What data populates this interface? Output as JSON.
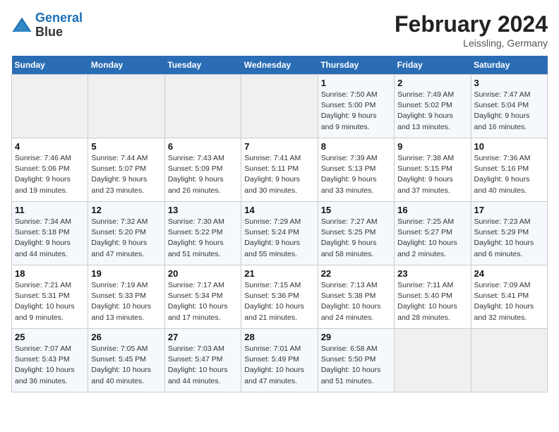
{
  "header": {
    "logo_line1": "General",
    "logo_line2": "Blue",
    "month": "February 2024",
    "location": "Leissling, Germany"
  },
  "weekdays": [
    "Sunday",
    "Monday",
    "Tuesday",
    "Wednesday",
    "Thursday",
    "Friday",
    "Saturday"
  ],
  "weeks": [
    [
      {
        "day": "",
        "info": ""
      },
      {
        "day": "",
        "info": ""
      },
      {
        "day": "",
        "info": ""
      },
      {
        "day": "",
        "info": ""
      },
      {
        "day": "1",
        "info": "Sunrise: 7:50 AM\nSunset: 5:00 PM\nDaylight: 9 hours\nand 9 minutes."
      },
      {
        "day": "2",
        "info": "Sunrise: 7:49 AM\nSunset: 5:02 PM\nDaylight: 9 hours\nand 13 minutes."
      },
      {
        "day": "3",
        "info": "Sunrise: 7:47 AM\nSunset: 5:04 PM\nDaylight: 9 hours\nand 16 minutes."
      }
    ],
    [
      {
        "day": "4",
        "info": "Sunrise: 7:46 AM\nSunset: 5:06 PM\nDaylight: 9 hours\nand 19 minutes."
      },
      {
        "day": "5",
        "info": "Sunrise: 7:44 AM\nSunset: 5:07 PM\nDaylight: 9 hours\nand 23 minutes."
      },
      {
        "day": "6",
        "info": "Sunrise: 7:43 AM\nSunset: 5:09 PM\nDaylight: 9 hours\nand 26 minutes."
      },
      {
        "day": "7",
        "info": "Sunrise: 7:41 AM\nSunset: 5:11 PM\nDaylight: 9 hours\nand 30 minutes."
      },
      {
        "day": "8",
        "info": "Sunrise: 7:39 AM\nSunset: 5:13 PM\nDaylight: 9 hours\nand 33 minutes."
      },
      {
        "day": "9",
        "info": "Sunrise: 7:38 AM\nSunset: 5:15 PM\nDaylight: 9 hours\nand 37 minutes."
      },
      {
        "day": "10",
        "info": "Sunrise: 7:36 AM\nSunset: 5:16 PM\nDaylight: 9 hours\nand 40 minutes."
      }
    ],
    [
      {
        "day": "11",
        "info": "Sunrise: 7:34 AM\nSunset: 5:18 PM\nDaylight: 9 hours\nand 44 minutes."
      },
      {
        "day": "12",
        "info": "Sunrise: 7:32 AM\nSunset: 5:20 PM\nDaylight: 9 hours\nand 47 minutes."
      },
      {
        "day": "13",
        "info": "Sunrise: 7:30 AM\nSunset: 5:22 PM\nDaylight: 9 hours\nand 51 minutes."
      },
      {
        "day": "14",
        "info": "Sunrise: 7:29 AM\nSunset: 5:24 PM\nDaylight: 9 hours\nand 55 minutes."
      },
      {
        "day": "15",
        "info": "Sunrise: 7:27 AM\nSunset: 5:25 PM\nDaylight: 9 hours\nand 58 minutes."
      },
      {
        "day": "16",
        "info": "Sunrise: 7:25 AM\nSunset: 5:27 PM\nDaylight: 10 hours\nand 2 minutes."
      },
      {
        "day": "17",
        "info": "Sunrise: 7:23 AM\nSunset: 5:29 PM\nDaylight: 10 hours\nand 6 minutes."
      }
    ],
    [
      {
        "day": "18",
        "info": "Sunrise: 7:21 AM\nSunset: 5:31 PM\nDaylight: 10 hours\nand 9 minutes."
      },
      {
        "day": "19",
        "info": "Sunrise: 7:19 AM\nSunset: 5:33 PM\nDaylight: 10 hours\nand 13 minutes."
      },
      {
        "day": "20",
        "info": "Sunrise: 7:17 AM\nSunset: 5:34 PM\nDaylight: 10 hours\nand 17 minutes."
      },
      {
        "day": "21",
        "info": "Sunrise: 7:15 AM\nSunset: 5:36 PM\nDaylight: 10 hours\nand 21 minutes."
      },
      {
        "day": "22",
        "info": "Sunrise: 7:13 AM\nSunset: 5:38 PM\nDaylight: 10 hours\nand 24 minutes."
      },
      {
        "day": "23",
        "info": "Sunrise: 7:11 AM\nSunset: 5:40 PM\nDaylight: 10 hours\nand 28 minutes."
      },
      {
        "day": "24",
        "info": "Sunrise: 7:09 AM\nSunset: 5:41 PM\nDaylight: 10 hours\nand 32 minutes."
      }
    ],
    [
      {
        "day": "25",
        "info": "Sunrise: 7:07 AM\nSunset: 5:43 PM\nDaylight: 10 hours\nand 36 minutes."
      },
      {
        "day": "26",
        "info": "Sunrise: 7:05 AM\nSunset: 5:45 PM\nDaylight: 10 hours\nand 40 minutes."
      },
      {
        "day": "27",
        "info": "Sunrise: 7:03 AM\nSunset: 5:47 PM\nDaylight: 10 hours\nand 44 minutes."
      },
      {
        "day": "28",
        "info": "Sunrise: 7:01 AM\nSunset: 5:49 PM\nDaylight: 10 hours\nand 47 minutes."
      },
      {
        "day": "29",
        "info": "Sunrise: 6:58 AM\nSunset: 5:50 PM\nDaylight: 10 hours\nand 51 minutes."
      },
      {
        "day": "",
        "info": ""
      },
      {
        "day": "",
        "info": ""
      }
    ]
  ]
}
